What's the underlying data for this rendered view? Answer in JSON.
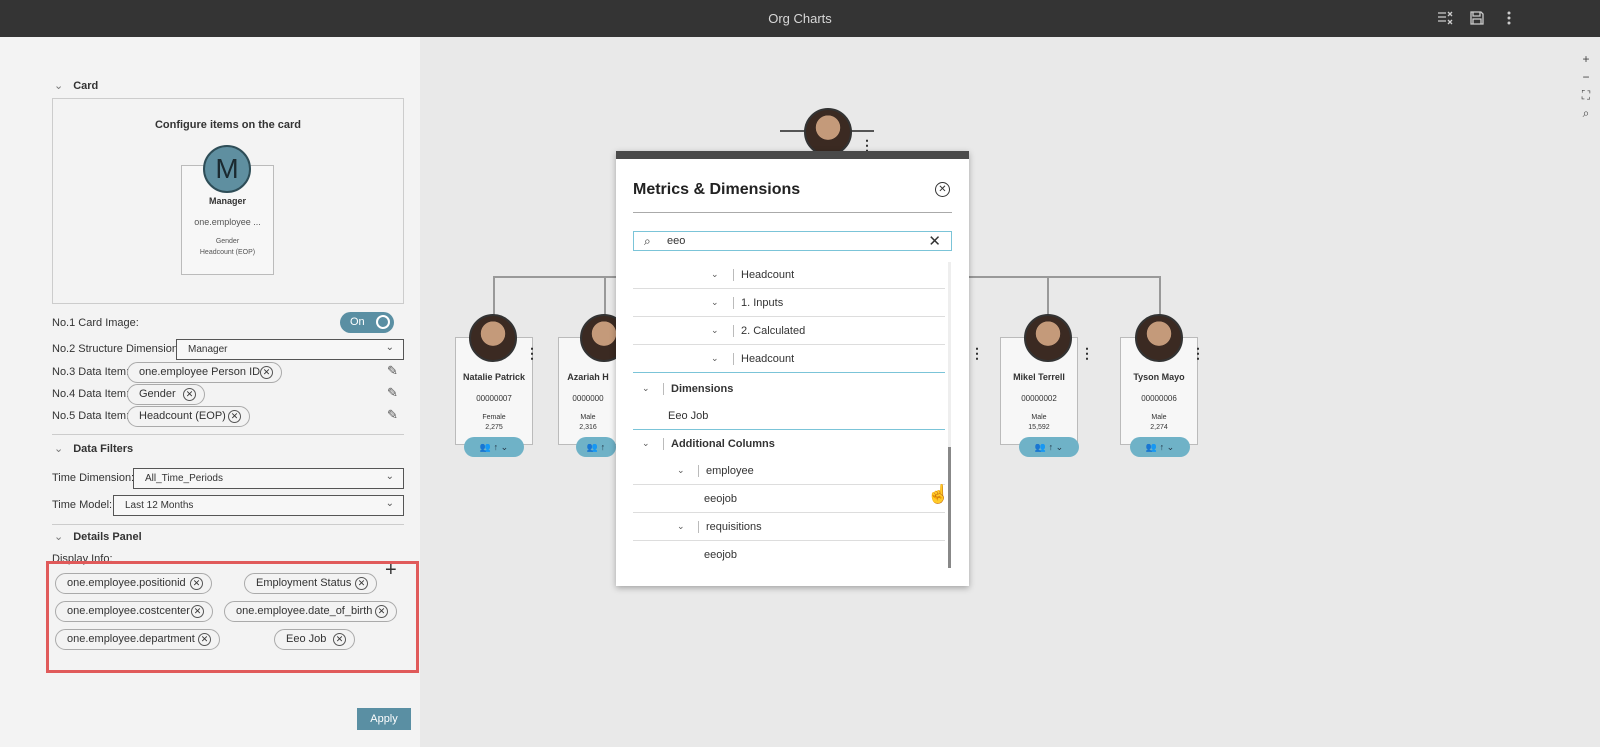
{
  "app": {
    "title": "Org Charts"
  },
  "topbar": {
    "icons": [
      "filter-list-icon",
      "save-icon",
      "more-vertical-icon"
    ]
  },
  "left_panel": {
    "card_section": {
      "title": "Card",
      "configure_title": "Configure items on the card",
      "preview": {
        "initial": "M",
        "name": "Manager",
        "line1": "one.employee ...",
        "line2": "Gender",
        "line3": "Headcount (EOP)"
      }
    },
    "card_image": {
      "label": "No.1 Card Image:",
      "toggle": "On"
    },
    "structure": {
      "label": "No.2 Structure Dimension:",
      "value": "Manager"
    },
    "data_items": [
      {
        "label": "No.3 Data Item:",
        "value": "one.employee Person ID"
      },
      {
        "label": "No.4 Data Item:",
        "value": "Gender"
      },
      {
        "label": "No.5 Data Item:",
        "value": "Headcount (EOP)"
      }
    ],
    "filters": {
      "title": "Data Filters",
      "time_dimension": {
        "label": "Time Dimension:",
        "value": "All_Time_Periods"
      },
      "time_model": {
        "label": "Time Model:",
        "value": "Last 12 Months"
      }
    },
    "details": {
      "title": "Details Panel",
      "display_label": "Display Info:",
      "chips": [
        "one.employee.positionid",
        "Employment Status",
        "one.employee.costcenter",
        "one.employee.date_of_birth",
        "one.employee.department",
        "Eeo Job"
      ]
    },
    "apply_label": "Apply"
  },
  "org_chart": {
    "people": [
      {
        "name": "Natalie Patrick",
        "id": "00000007",
        "gender": "Female",
        "headcount": "2,275"
      },
      {
        "name": "Azariah H",
        "id": "0000000",
        "gender": "Male",
        "headcount": "2,316"
      },
      {
        "name": "Mikel Terrell",
        "id": "00000002",
        "gender": "Male",
        "headcount": "15,592"
      },
      {
        "name": "Tyson Mayo",
        "id": "00000006",
        "gender": "Male",
        "headcount": "2,274"
      }
    ],
    "zoom_controls": [
      "+",
      "−",
      "⛶",
      "⌕"
    ]
  },
  "modal": {
    "title": "Metrics & Dimensions",
    "search_value": "eeo",
    "rows": [
      {
        "label": "Headcount"
      },
      {
        "label": "1. Inputs"
      },
      {
        "label": "2. Calculated"
      },
      {
        "label": "Headcount"
      },
      {
        "label": "Dimensions"
      },
      {
        "label": "Eeo Job"
      },
      {
        "label": "Additional Columns"
      },
      {
        "label": "employee"
      },
      {
        "label": "eeojob"
      },
      {
        "label": "requisitions"
      },
      {
        "label": "eeojob"
      }
    ]
  }
}
